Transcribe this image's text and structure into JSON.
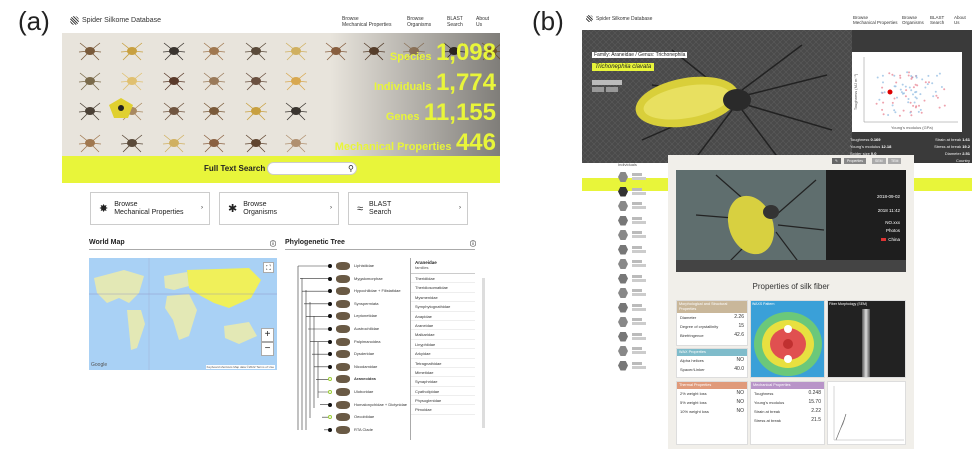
{
  "panel_labels": {
    "a": "(a)",
    "b": "(b)"
  },
  "panel_a": {
    "logo": "Spider Silkome Database",
    "nav": [
      {
        "l1": "Browse",
        "l2": "Mechanical Properties"
      },
      {
        "l1": "Browse",
        "l2": "Organisms"
      },
      {
        "l1": "BLAST",
        "l2": "Search"
      },
      {
        "l1": "About",
        "l2": "Us"
      }
    ],
    "stats": [
      {
        "label": "Species",
        "value": "1,098"
      },
      {
        "label": "Individuals",
        "value": "1,774"
      },
      {
        "label": "Genes",
        "value": "11,155"
      },
      {
        "label": "Mechanical Properties",
        "value": "446"
      }
    ],
    "search_label": "Full Text Search",
    "browse_buttons": [
      {
        "l1": "Browse",
        "l2": "Mechanical Properties",
        "icon": "spider-web-icon"
      },
      {
        "l1": "Browse",
        "l2": "Organisms",
        "icon": "spider-icon"
      },
      {
        "l1": "BLAST",
        "l2": "Search",
        "icon": "dna-icon"
      }
    ],
    "world_map_title": "World Map",
    "tree_title": "Phylogenetic Tree",
    "map_attribution": "Keyboard shortcuts   Map data ©2022   Terms of Use",
    "map_google": "Google",
    "tree_nodes": [
      "Liphistiidae",
      "Mygalomorphae",
      "Hypochilidae + Filistatidae",
      "Synspermiata",
      "Leptonetidae",
      "Austrochilidae",
      "Palpimanoidea",
      "Dysderidae",
      "Nicodamidae",
      "Araneoidea",
      "Uloboridae",
      "Homalonychidae + Dictynidae",
      "Oecobiidae",
      "RTA Clade"
    ],
    "family_header": "Araneidae",
    "family_sub": "families",
    "families": [
      "Theridiidae",
      "Theridiosomatidae",
      "Mysmenidae",
      "Symphytognathidae",
      "Anapidae",
      "Araneidae",
      "Malkaridae",
      "Linyphiidae",
      "Arkyidae",
      "Tetragnathidae",
      "Mimetidae",
      "Synaphridae",
      "Cyatholipidae",
      "Physoglenidae",
      "Pimoidae"
    ],
    "spider_colors": [
      "#7a5a3a",
      "#c8a040",
      "#3a3530",
      "#a07850",
      "#5a4a3a",
      "#d0b060",
      "#8a6040",
      "#604530",
      "#b09070",
      "#403530",
      "#c09050",
      "#7a6a4a",
      "#e0c070",
      "#5a3a2a",
      "#9a7a5a",
      "#6a5040",
      "#d8a850",
      "#4a4035",
      "#a88860",
      "#705540"
    ]
  },
  "panel_b": {
    "logo": "Spider Silkome Database",
    "nav": [
      {
        "l1": "Browse",
        "l2": "Mechanical Properties"
      },
      {
        "l1": "Browse",
        "l2": "Organisms"
      },
      {
        "l1": "BLAST",
        "l2": "Search"
      },
      {
        "l1": "About",
        "l2": "Us"
      }
    ],
    "taxonomy": "Family: Araneidae / Genus: Trichonephila",
    "species": "Trichonephila clavata",
    "hero_stats": [
      {
        "k": "Toughness",
        "v": "0.169"
      },
      {
        "k": "Strain at break",
        "v": "1.61"
      },
      {
        "k": "Young's modulus",
        "v": "12.18"
      },
      {
        "k": "Stress at break",
        "v": "19.2"
      },
      {
        "k": "Spider size",
        "v": "0.0"
      },
      {
        "k": "Diameter",
        "v": "2.51"
      },
      {
        "k": "Sex",
        "v": "♀ ?"
      },
      {
        "k": "Country",
        "v": ""
      }
    ],
    "scatter_ylabel": "Toughness (MJ m⁻³)",
    "scatter_xlabel": "Young's modulus (GPa)",
    "list_title": "Individuals",
    "photo_info": [
      "2018-09-02",
      "2018 11:42",
      "NO.xxx",
      "Photos",
      "China"
    ],
    "props_title": "Properties of silk fiber",
    "tabs": [
      "Properties",
      "SEM",
      "TEM"
    ],
    "card_morph": {
      "title": "Morphological and Structural Properties",
      "rows": [
        {
          "k": "Diameter",
          "v": "2.26"
        },
        {
          "k": "Degree of crystallinity",
          "v": "15"
        },
        {
          "k": "Birefringence",
          "v": "42.6"
        }
      ]
    },
    "card_wax": {
      "title": "WAX Properties",
      "rows": [
        {
          "k": "Alpha helices",
          "v": "NO"
        },
        {
          "k": "Spacer/Linker",
          "v": "40.0"
        }
      ]
    },
    "card_thermal": {
      "title": "Thermal Properties",
      "rows": [
        {
          "k": "2% weight loss",
          "v": "NO"
        },
        {
          "k": "5% weight loss",
          "v": "NO"
        },
        {
          "k": "10% weight loss",
          "v": "NO"
        }
      ]
    },
    "card_mech": {
      "title": "Mechanical Properties",
      "rows": [
        {
          "k": "Toughness",
          "v": "0.248"
        },
        {
          "k": "Young's modulus",
          "v": "15.70"
        },
        {
          "k": "Strain at break",
          "v": "2.22"
        },
        {
          "k": "Stress at break",
          "v": "21.5"
        }
      ]
    },
    "waxs_title": "WAXS Pattern",
    "fiber_title": "Fiber Morphology (SEM)"
  }
}
